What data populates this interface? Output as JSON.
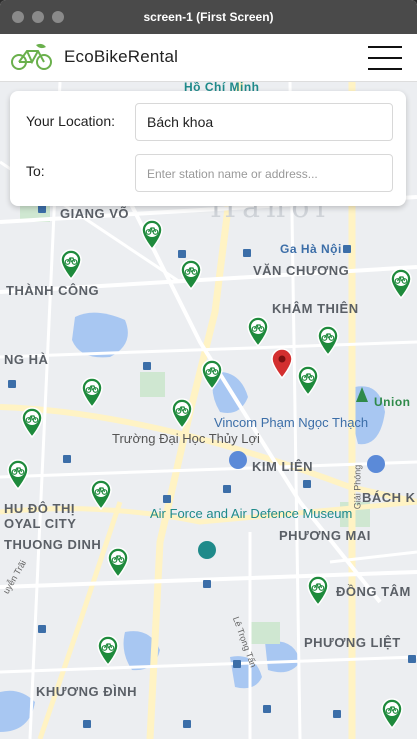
{
  "window": {
    "title": "screen-1 (First Screen)"
  },
  "header": {
    "brand": "EcoBikeRental",
    "logo_icon": "bicycle-leaf-icon",
    "menu_icon": "hamburger-menu-icon"
  },
  "search": {
    "from_label": "Your Location:",
    "from_value": "Bách khoa",
    "to_label": "To:",
    "to_placeholder": "Enter station name or address..."
  },
  "map": {
    "area_labels": [
      "Hồ Chí Minh",
      "GIANG VÕ",
      "THÀNH CÔNG",
      "VĂN CHƯƠNG",
      "KHÂM THIÊN",
      "NG HÀ",
      "KIM LIÊN",
      "HU ĐÔ THỊ",
      "OYAL CITY",
      "THUONG DINH",
      "PHƯƠNG MAI",
      "BÁCH K",
      "ĐỒNG TÂM",
      "PHƯƠNG LIỆT",
      "KHƯƠNG ĐÌNH",
      "Ga Hà Nội",
      "Union",
      "Hanoi"
    ],
    "poi_labels": [
      "Vincom Phạm Ngọc Thạch",
      "Trường Đại Học Thủy Lợi",
      "Air Force and Air Defence Museum"
    ],
    "street_labels": [
      "Giải Phóng",
      "Lê Trọng Tấn",
      "uyễn Trãi"
    ],
    "station_marker_icon": "bike-station-pin-icon",
    "selected_marker_icon": "location-pin-icon",
    "station_color": "#1e8a3c",
    "selected_color": "#d32f2f"
  }
}
